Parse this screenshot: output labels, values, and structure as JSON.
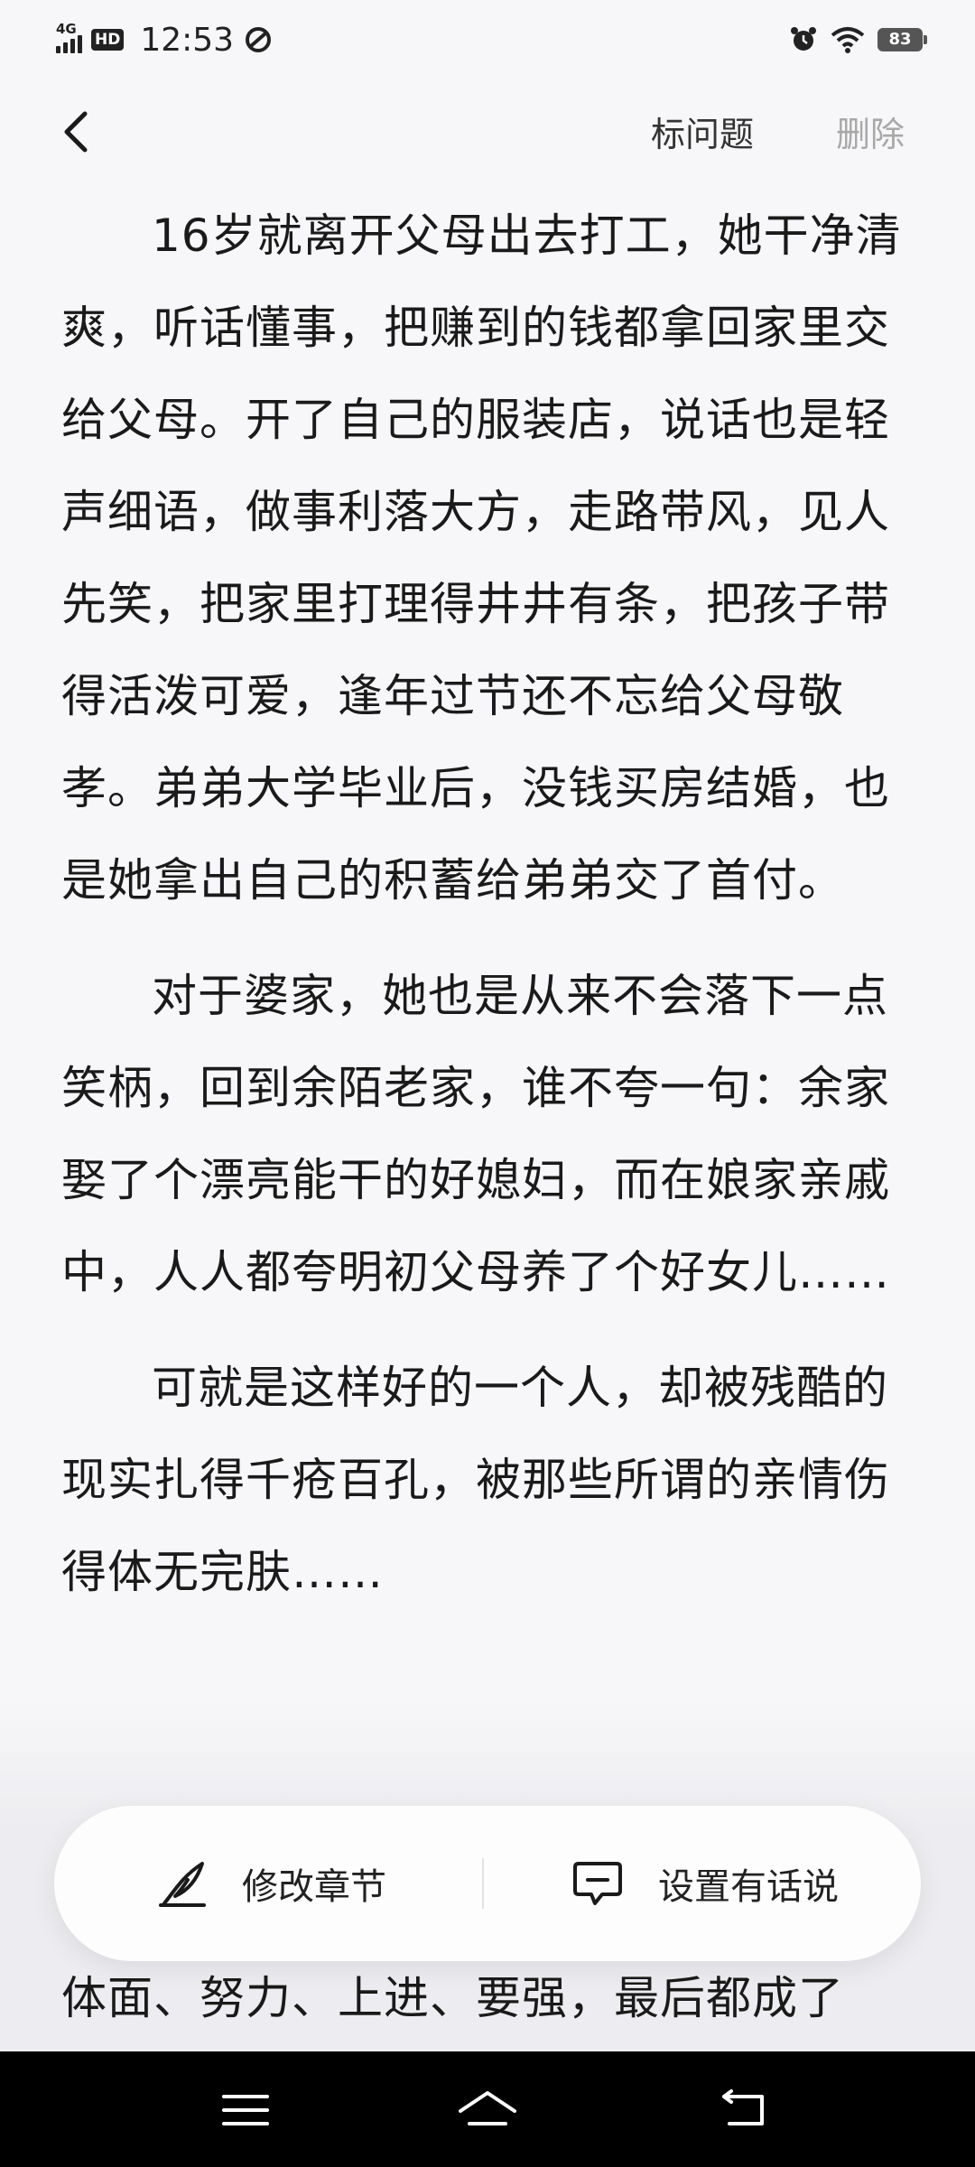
{
  "status_bar": {
    "network": "4G",
    "hd": "HD",
    "time": "12:53",
    "battery": "83",
    "icons": [
      "signal-icon",
      "hd-icon",
      "sync-icon",
      "alarm-icon",
      "wifi-icon",
      "battery-icon"
    ]
  },
  "top_bar": {
    "back_icon": "back-chevron-icon",
    "mark_label": "标问题",
    "delete_label": "删除"
  },
  "article": {
    "paragraphs": [
      "16岁就离开父母出去打工，她干净清爽，听话懂事，把赚到的钱都拿回家里交给父母。开了自己的服装店，说话也是轻声细语，做事利落大方，走路带风，见人先笑，把家里打理得井井有条，把孩子带得活泼可爱，逢年过节还不忘给父母敬孝。弟弟大学毕业后，没钱买房结婚，也是她拿出自己的积蓄给弟弟交了首付。",
      "对于婆家，她也是从来不会落下一点笑柄，回到余陌老家，谁不夸一句：余家娶了个漂亮能干的好媳妇，而在娘家亲戚中，人人都夸明初父母养了个好女儿……",
      "可就是这样好的一个人，却被残酷的现实扎得千疮百孔，被那些所谓的亲情伤得体无完肤……"
    ],
    "partial_line": "体面、努力、上进、要强，最后都成了"
  },
  "action_bar": {
    "edit_label": "修改章节",
    "edit_icon": "quill-pen-icon",
    "comment_label": "设置有话说",
    "comment_icon": "comment-bubble-icon"
  },
  "nav_bar": {
    "icons": [
      "menu-icon",
      "home-icon",
      "back-icon"
    ]
  }
}
